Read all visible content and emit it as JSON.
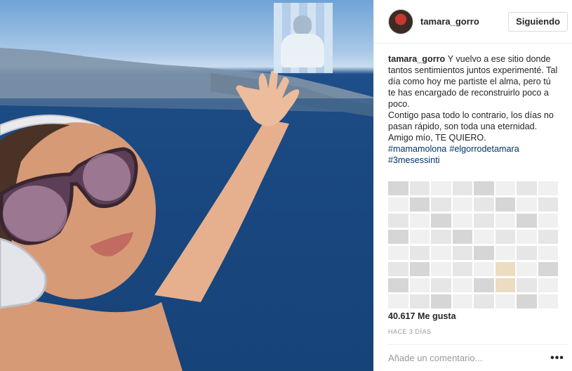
{
  "post": {
    "username": "tamara_gorro",
    "follow_button": "Siguiendo",
    "caption_user": "tamara_gorro",
    "caption_text": "Y vuelvo a ese sitio donde tantos sentimientos juntos experimenté. Tal día como hoy me partiste el alma, pero tú te has encargado de reconstruirlo poco a poco.\nContigo pasa todo lo contrario, los días no pasan rápido, son toda una eternidad. Amigo mío, TE QUIERO.",
    "hashtags": [
      "#mamamolona",
      "#elgorrodetamara",
      "#3mesessinti"
    ],
    "likes": "40.617 Me gusta",
    "time": "HACE 3 DÍAS",
    "comment_placeholder": "Añade un comentario...",
    "more_icon": "more-options-icon"
  },
  "colors": {
    "hashtag": "#003569",
    "text": "#262626",
    "muted": "#999999"
  }
}
